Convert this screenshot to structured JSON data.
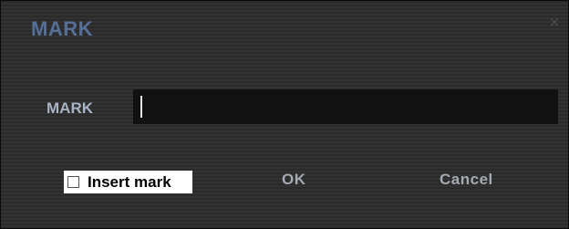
{
  "dialog": {
    "title": "MARK",
    "close_icon": "close-icon",
    "close_glyph": "×"
  },
  "field": {
    "label": "MARK",
    "value": ""
  },
  "insert_mark": {
    "label": "Insert mark",
    "checked": false
  },
  "buttons": {
    "ok_label": "OK",
    "cancel_label": "Cancel"
  },
  "colors": {
    "title": "#566f96",
    "label": "#a8b4c4",
    "button_text": "#a5a9b1",
    "input_bg": "#111111"
  }
}
